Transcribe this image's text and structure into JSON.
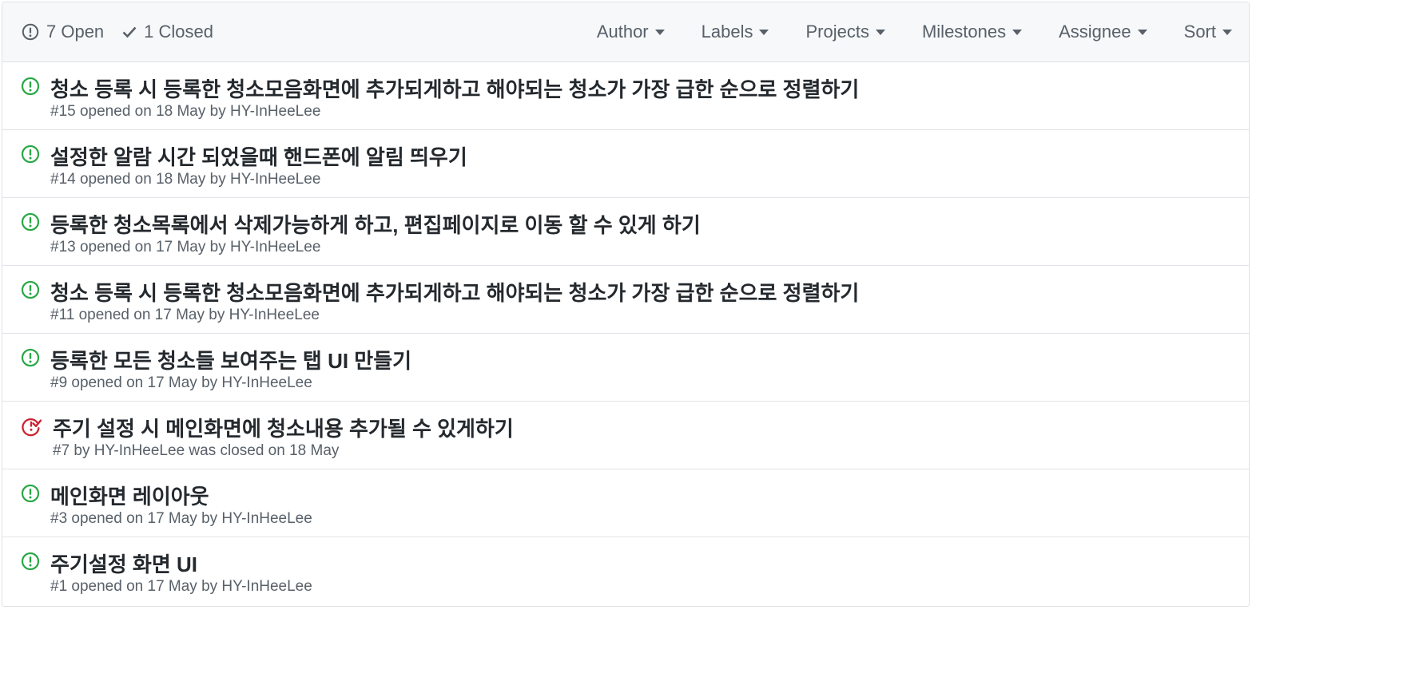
{
  "header": {
    "open_label": "7 Open",
    "closed_label": "1 Closed",
    "filters": [
      "Author",
      "Labels",
      "Projects",
      "Milestones",
      "Assignee",
      "Sort"
    ]
  },
  "issues": [
    {
      "title": "청소 등록 시 등록한 청소모음화면에 추가되게하고 해야되는 청소가 가장 급한 순으로 정렬하기",
      "meta": "#15 opened on 18 May by HY-InHeeLee",
      "state": "open"
    },
    {
      "title": "설정한 알람 시간 되었을때 핸드폰에 알림 띄우기",
      "meta": "#14 opened on 18 May by HY-InHeeLee",
      "state": "open"
    },
    {
      "title": "등록한 청소목록에서 삭제가능하게 하고, 편집페이지로 이동 할 수 있게 하기",
      "meta": "#13 opened on 17 May by HY-InHeeLee",
      "state": "open"
    },
    {
      "title": "청소 등록 시 등록한 청소모음화면에 추가되게하고 해야되는 청소가 가장 급한 순으로 정렬하기",
      "meta": "#11 opened on 17 May by HY-InHeeLee",
      "state": "open"
    },
    {
      "title": "등록한 모든 청소들 보여주는 탭 UI 만들기",
      "meta": "#9 opened on 17 May by HY-InHeeLee",
      "state": "open"
    },
    {
      "title": "주기 설정 시 메인화면에 청소내용 추가될 수 있게하기",
      "meta": "#7 by HY-InHeeLee was closed on 18 May",
      "state": "closed"
    },
    {
      "title": "메인화면 레이아웃",
      "meta": "#3 opened on 17 May by HY-InHeeLee",
      "state": "open"
    },
    {
      "title": "주기설정 화면 UI",
      "meta": "#1 opened on 17 May by HY-InHeeLee",
      "state": "open"
    }
  ],
  "colors": {
    "open_icon": "#28a745",
    "closed_icon": "#cb2431",
    "muted_text": "#586069",
    "title_text": "#24292e",
    "header_bg": "#f6f8fa",
    "border": "#dfe2e5"
  }
}
